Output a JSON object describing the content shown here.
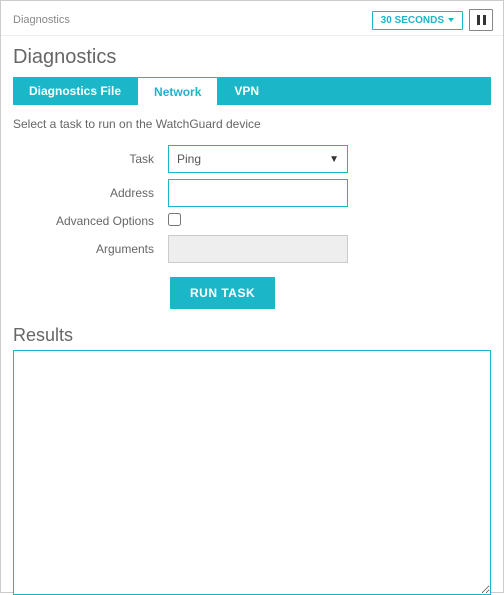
{
  "breadcrumb": "Diagnostics",
  "header": {
    "interval_label": "30 SECONDS"
  },
  "page_title": "Diagnostics",
  "tabs": [
    {
      "label": "Diagnostics File",
      "active": false
    },
    {
      "label": "Network",
      "active": true
    },
    {
      "label": "VPN",
      "active": false
    }
  ],
  "instructions": "Select a task to run on the WatchGuard device",
  "form": {
    "task_label": "Task",
    "task_value": "Ping",
    "address_label": "Address",
    "address_value": "",
    "advanced_label": "Advanced Options",
    "advanced_checked": false,
    "arguments_label": "Arguments",
    "arguments_value": "",
    "run_button_label": "RUN TASK"
  },
  "results": {
    "title": "Results",
    "content": ""
  },
  "colors": {
    "accent": "#1cb6c9"
  }
}
